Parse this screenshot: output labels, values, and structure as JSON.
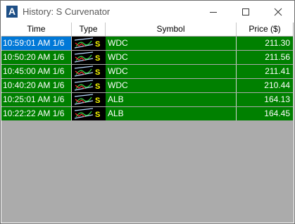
{
  "window": {
    "app_icon_letter": "A",
    "title": "History:  S Curvenator"
  },
  "controls": {
    "minimize_icon": "minimize-icon",
    "maximize_icon": "maximize-icon",
    "close_icon": "close-icon"
  },
  "columns": [
    "Time",
    "Type",
    "Symbol",
    "Price ($)"
  ],
  "rows": [
    {
      "time": "10:59:01 AM 1/6",
      "type_icon": "s-curve-alert-icon",
      "symbol": "WDC",
      "price": "211.30",
      "selected": true
    },
    {
      "time": "10:50:20 AM 1/6",
      "type_icon": "s-curve-alert-icon",
      "symbol": "WDC",
      "price": "211.56",
      "selected": false
    },
    {
      "time": "10:45:00 AM 1/6",
      "type_icon": "s-curve-alert-icon",
      "symbol": "WDC",
      "price": "211.41",
      "selected": false
    },
    {
      "time": "10:40:20 AM 1/6",
      "type_icon": "s-curve-alert-icon",
      "symbol": "WDC",
      "price": "210.44",
      "selected": false
    },
    {
      "time": "10:25:01 AM 1/6",
      "type_icon": "s-curve-alert-icon",
      "symbol": "ALB",
      "price": "164.13",
      "selected": false
    },
    {
      "time": "10:22:22 AM 1/6",
      "type_icon": "s-curve-alert-icon",
      "symbol": "ALB",
      "price": "164.45",
      "selected": false
    }
  ],
  "colors": {
    "row_background": "#008000",
    "selected_cell": "#0078d7",
    "empty_area": "#ababab",
    "app_icon": "#1e4f86"
  }
}
